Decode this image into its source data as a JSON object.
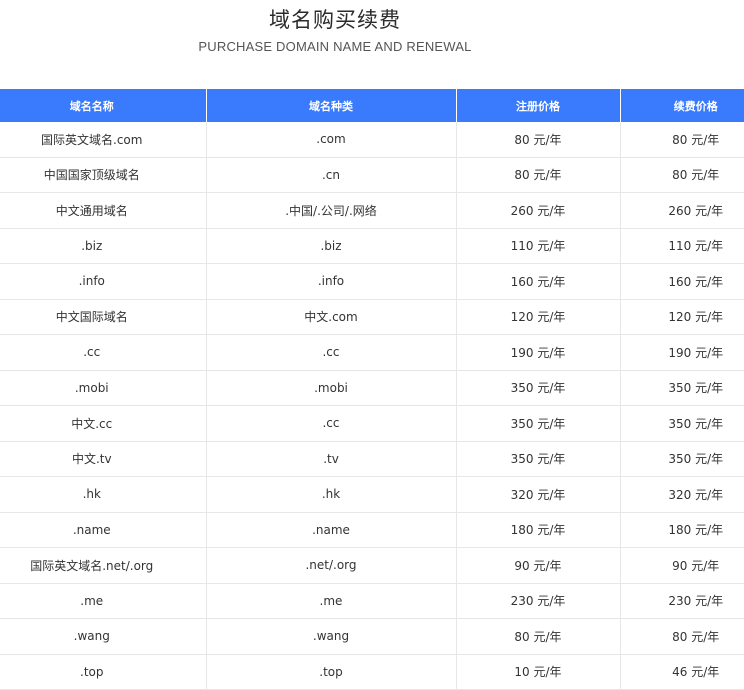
{
  "title": "域名购买续费",
  "subtitle": "PURCHASE DOMAIN NAME AND RENEWAL",
  "colors": {
    "header_bg": "#3a7afc",
    "header_text": "#ffffff",
    "grid": "#e7e7e7"
  },
  "table": {
    "headers": [
      "域名名称",
      "域名种类",
      "注册价格",
      "续费价格"
    ],
    "rows": [
      [
        "国际英文域名.com",
        ".com",
        "80 元/年",
        "80 元/年"
      ],
      [
        "中国国家顶级域名",
        ".cn",
        "80 元/年",
        "80 元/年"
      ],
      [
        "中文通用域名",
        ".中国/.公司/.网络",
        "260 元/年",
        "260 元/年"
      ],
      [
        ".biz",
        ".biz",
        "110 元/年",
        "110 元/年"
      ],
      [
        ".info",
        ".info",
        "160 元/年",
        "160 元/年"
      ],
      [
        "中文国际域名",
        "中文.com",
        "120 元/年",
        "120 元/年"
      ],
      [
        ".cc",
        ".cc",
        "190 元/年",
        "190 元/年"
      ],
      [
        ".mobi",
        ".mobi",
        "350 元/年",
        "350 元/年"
      ],
      [
        "中文.cc",
        ".cc",
        "350 元/年",
        "350 元/年"
      ],
      [
        "中文.tv",
        ".tv",
        "350 元/年",
        "350 元/年"
      ],
      [
        ".hk",
        ".hk",
        "320 元/年",
        "320 元/年"
      ],
      [
        ".name",
        ".name",
        "180 元/年",
        "180 元/年"
      ],
      [
        "国际英文域名.net/.org",
        ".net/.org",
        "90 元/年",
        "90 元/年"
      ],
      [
        ".me",
        ".me",
        "230 元/年",
        "230 元/年"
      ],
      [
        ".wang",
        ".wang",
        "80 元/年",
        "80 元/年"
      ],
      [
        ".top",
        ".top",
        "10 元/年",
        "46 元/年"
      ]
    ]
  }
}
